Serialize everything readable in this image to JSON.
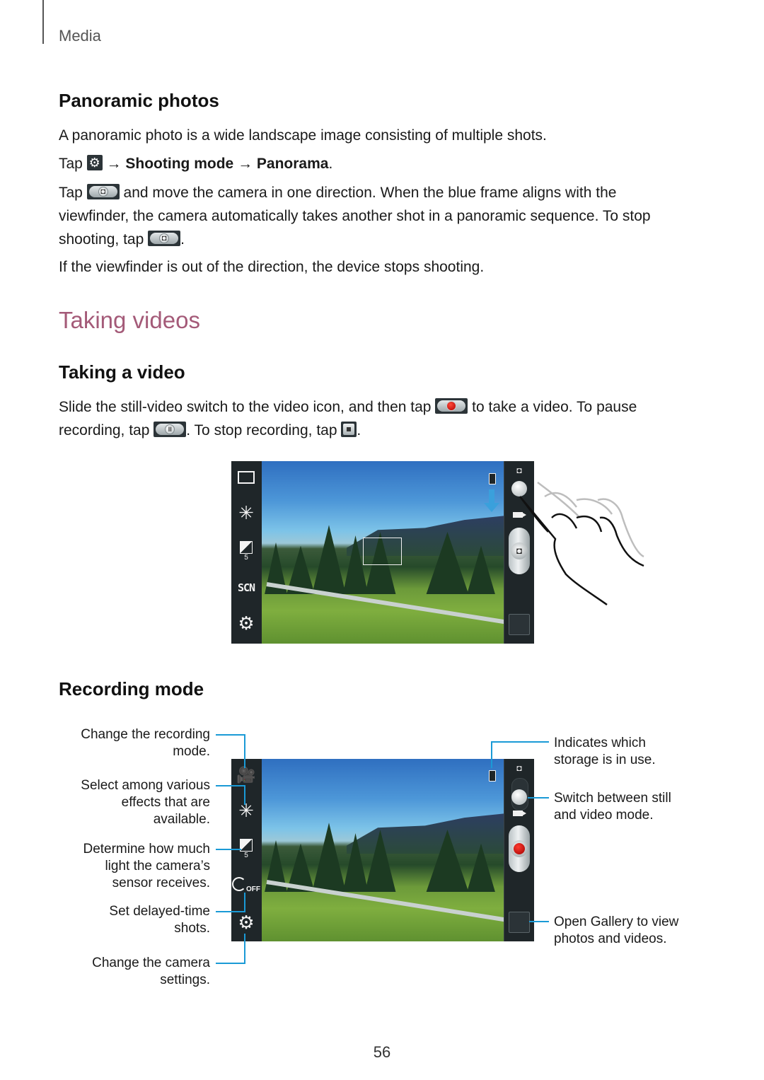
{
  "header": {
    "section": "Media"
  },
  "panoramic": {
    "heading": "Panoramic photos",
    "intro": "A panoramic photo is a wide landscape image consisting of multiple shots.",
    "step1": {
      "tap": "Tap",
      "arrow1": "→",
      "menu1": "Shooting mode",
      "arrow2": "→",
      "menu2": "Panorama",
      "end": ".",
      "icon": "settings-gear-icon"
    },
    "step2": {
      "line1_tap": "Tap",
      "line1_rest": "and move the camera in one direction. When the blue frame aligns with the",
      "line2": "viewfinder, the camera automatically takes another shot in a panoramic sequence. To stop",
      "line3_start": "shooting, tap",
      "line3_end": ".",
      "icon": "camera-shutter-icon"
    },
    "note": "If the viewfinder is out of the direction, the device stops shooting."
  },
  "videos": {
    "heading": "Taking videos",
    "heading_color": "#a45a78",
    "subheading": "Taking a video",
    "line1_start": "Slide the still-video switch to the video icon, and then tap",
    "line1_end": "to take a video. To pause",
    "line2_start": "recording, tap",
    "line2_mid": ". To stop recording, tap",
    "line2_end": ".",
    "icons": [
      "record-icon",
      "pause-icon",
      "stop-icon"
    ]
  },
  "camera_screen_1": {
    "left_toolbar": [
      "shooting-mode-icon",
      "effects-icon",
      "exposure-icon",
      "scene-mode-icon",
      "settings-icon"
    ],
    "exposure_value": "5",
    "scene_label": "SCN",
    "right_toolbar": [
      "camera-icon",
      "still-video-switch",
      "shutter-button",
      "gallery-thumbnail"
    ]
  },
  "recording_mode": {
    "heading": "Recording mode",
    "exposure_value": "5",
    "timer_label": "OFF",
    "callouts_left": [
      {
        "lines": [
          "Change the recording",
          "mode."
        ]
      },
      {
        "lines": [
          "Select among various",
          "effects that are",
          "available."
        ]
      },
      {
        "lines": [
          "Determine how much",
          "light the camera’s",
          "sensor receives."
        ]
      },
      {
        "lines": [
          "Set delayed-time",
          "shots."
        ]
      },
      {
        "lines": [
          "Change the camera",
          "settings."
        ]
      }
    ],
    "callouts_right": [
      {
        "lines": [
          "Indicates which",
          "storage is in use."
        ]
      },
      {
        "lines": [
          "Switch between still",
          "and video mode."
        ]
      },
      {
        "lines": [
          "Open Gallery to view",
          "photos and videos."
        ]
      }
    ],
    "callout_color": "#1a9ad6"
  },
  "footer": {
    "page_number": "56"
  }
}
